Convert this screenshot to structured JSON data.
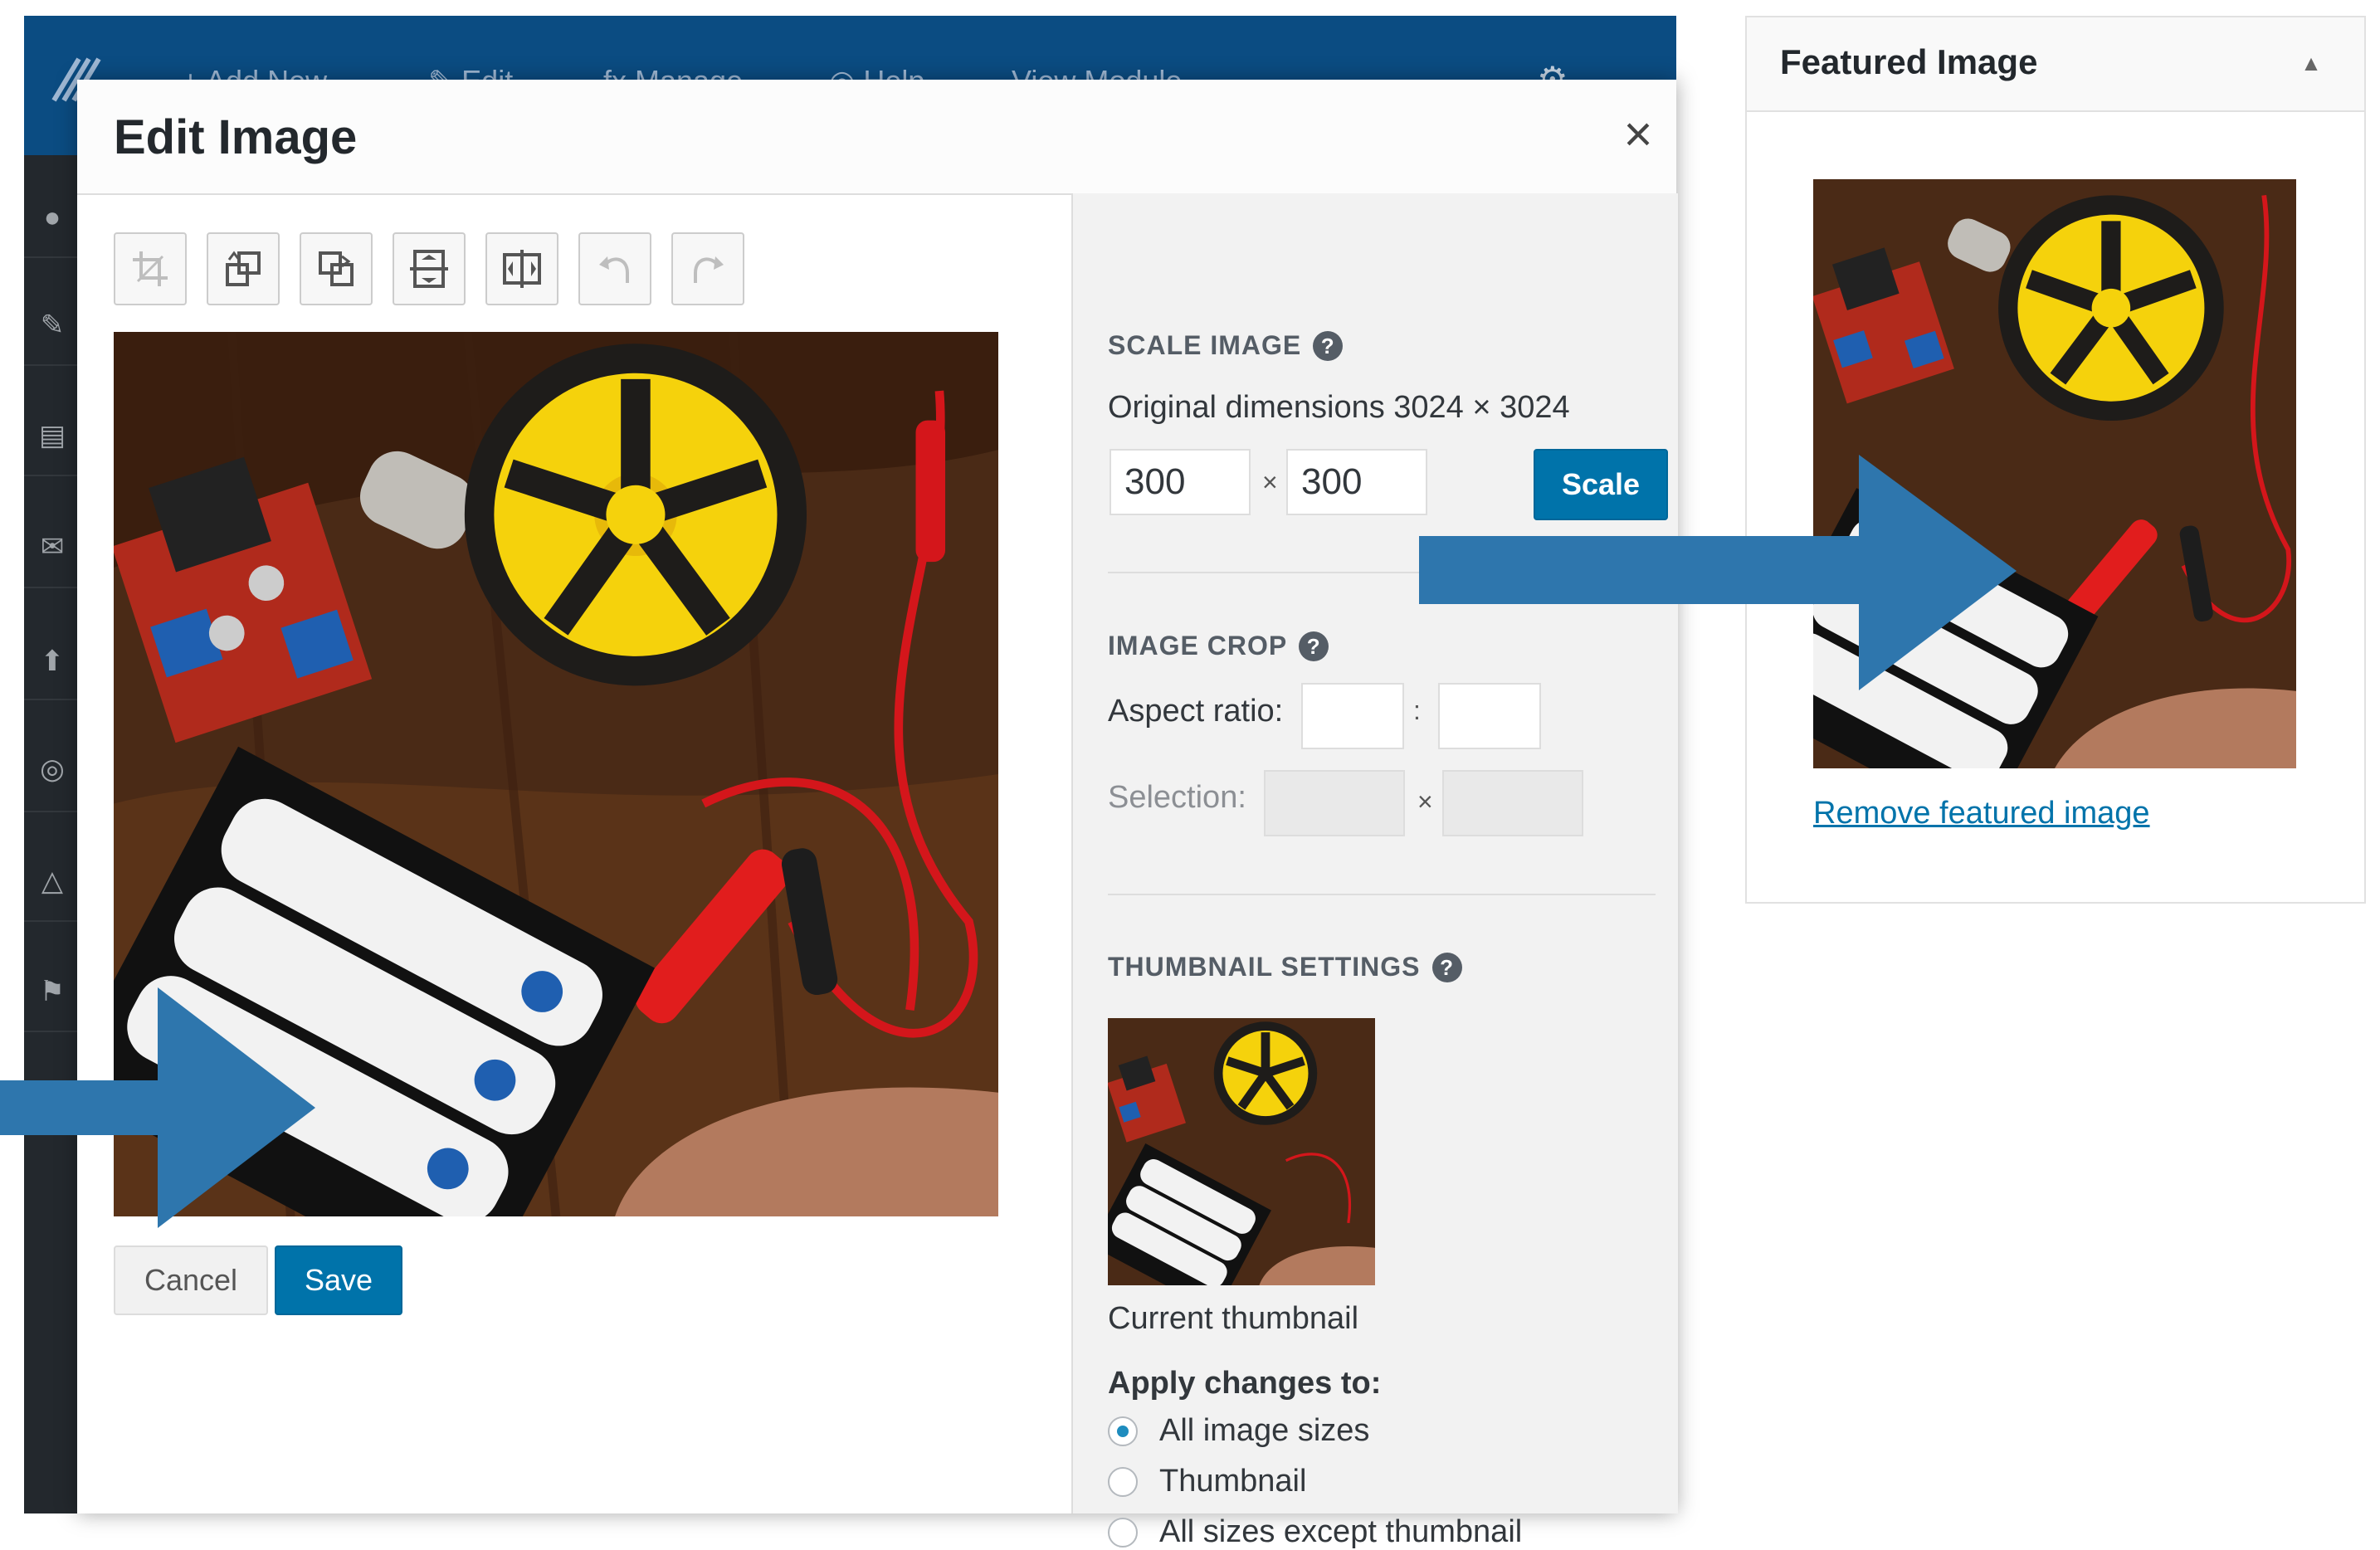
{
  "admin_bar": {
    "items": [
      "+ Add New",
      "✎ Edit",
      "fx Manage",
      "◎ Help",
      "View Module"
    ]
  },
  "modal": {
    "title": "Edit Image",
    "close_icon": "close-icon",
    "toolbar": [
      {
        "name": "crop-button",
        "icon": "crop-icon",
        "enabled": false
      },
      {
        "name": "rotate-left-button",
        "icon": "rotate-left-icon",
        "enabled": true
      },
      {
        "name": "rotate-right-button",
        "icon": "rotate-right-icon",
        "enabled": true
      },
      {
        "name": "flip-vertical-button",
        "icon": "flip-vertical-icon",
        "enabled": true
      },
      {
        "name": "flip-horizontal-button",
        "icon": "flip-horizontal-icon",
        "enabled": true
      },
      {
        "name": "undo-button",
        "icon": "undo-icon",
        "enabled": false
      },
      {
        "name": "redo-button",
        "icon": "redo-icon",
        "enabled": false
      }
    ],
    "cancel_label": "Cancel",
    "save_label": "Save"
  },
  "scale": {
    "heading": "SCALE IMAGE",
    "original_dimensions": "Original dimensions 3024 × 3024",
    "width_value": "300",
    "height_value": "300",
    "separator": "×",
    "button_label": "Scale"
  },
  "crop": {
    "heading": "IMAGE CROP",
    "aspect_label": "Aspect ratio:",
    "aspect_separator": ":",
    "selection_label": "Selection:",
    "selection_separator": "×"
  },
  "thumbnail": {
    "heading": "THUMBNAIL SETTINGS",
    "caption": "Current thumbnail",
    "apply_label": "Apply changes to:",
    "options": [
      {
        "label": "All image sizes",
        "checked": true
      },
      {
        "label": "Thumbnail",
        "checked": false
      },
      {
        "label": "All sizes except thumbnail",
        "checked": false
      }
    ]
  },
  "featured": {
    "title": "Featured Image",
    "remove_label": "Remove featured image"
  },
  "colors": {
    "primary_button": "#0073aa",
    "admin_bar": "#0b4c82",
    "admin_menu": "#23282d",
    "arrow": "#2e76ad"
  }
}
